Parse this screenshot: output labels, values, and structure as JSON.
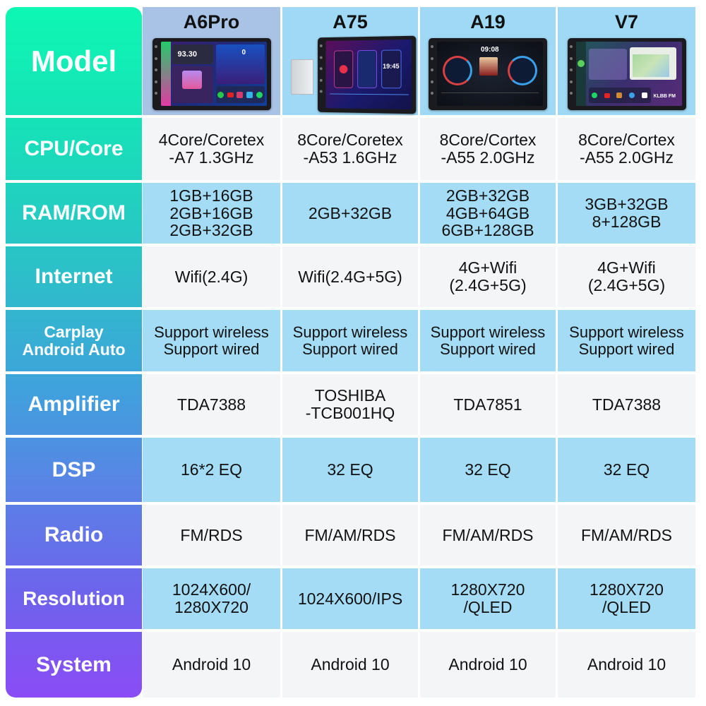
{
  "table": {
    "row_labels": [
      "Model",
      "CPU/Core",
      "RAM/ROM",
      "Internet",
      "Carplay\nAndroid Auto",
      "Amplifier",
      "DSP",
      "Radio",
      "Resolution",
      "System"
    ],
    "models": [
      {
        "name": "A6Pro",
        "image": "car-stereo-a6pro-icon",
        "screen_text": "93.30",
        "speed_text": "0",
        "cpu": "4Core/Coretex\n-A7 1.3GHz",
        "ram_rom": "1GB+16GB\n2GB+16GB\n2GB+32GB",
        "internet": "Wifi(2.4G)",
        "carplay": "Support wireless\nSupport wired",
        "amplifier": "TDA7388",
        "dsp": "16*2 EQ",
        "radio": "FM/RDS",
        "resolution": "1024X600/\n1280X720",
        "system": "Android 10"
      },
      {
        "name": "A75",
        "image": "car-stereo-a75-icon",
        "screen_text": "19:45",
        "cpu": "8Core/Coretex\n-A53 1.6GHz",
        "ram_rom": "2GB+32GB",
        "internet": "Wifi(2.4G+5G)",
        "carplay": "Support wireless\nSupport wired",
        "amplifier": "TOSHIBA\n-TCB001HQ",
        "dsp": "32 EQ",
        "radio": "FM/AM/RDS",
        "resolution": "1024X600/IPS",
        "system": "Android 10"
      },
      {
        "name": "A19",
        "image": "car-stereo-a19-icon",
        "screen_text": "09:08",
        "cpu": "8Core/Cortex\n-A55 2.0GHz",
        "ram_rom": "2GB+32GB\n4GB+64GB\n6GB+128GB",
        "internet": "4G+Wifi\n(2.4G+5G)",
        "carplay": "Support wireless\nSupport wired",
        "amplifier": "TDA7851",
        "dsp": "32 EQ",
        "radio": "FM/AM/RDS",
        "resolution": "1280X720\n/QLED",
        "system": "Android 10"
      },
      {
        "name": "V7",
        "image": "car-stereo-v7-icon",
        "screen_text": "KLBB FM",
        "cpu": "8Core/Cortex\n-A55 2.0GHz",
        "ram_rom": "3GB+32GB\n8+128GB",
        "internet": "4G+Wifi\n(2.4G+5G)",
        "carplay": "Support wireless\nSupport wired",
        "amplifier": "TDA7388",
        "dsp": "32 EQ",
        "radio": "FM/AM/RDS",
        "resolution": "1280X720\n/QLED",
        "system": "Android 10"
      }
    ]
  },
  "colors": {
    "label_gradient_top": "#0ef7b3",
    "label_gradient_bottom": "#8a4cf6",
    "row_gray": "#f4f5f7",
    "row_blue": "#a4dcf6",
    "header_first": "#a9c3e6",
    "header_other": "#9fd9f5"
  }
}
